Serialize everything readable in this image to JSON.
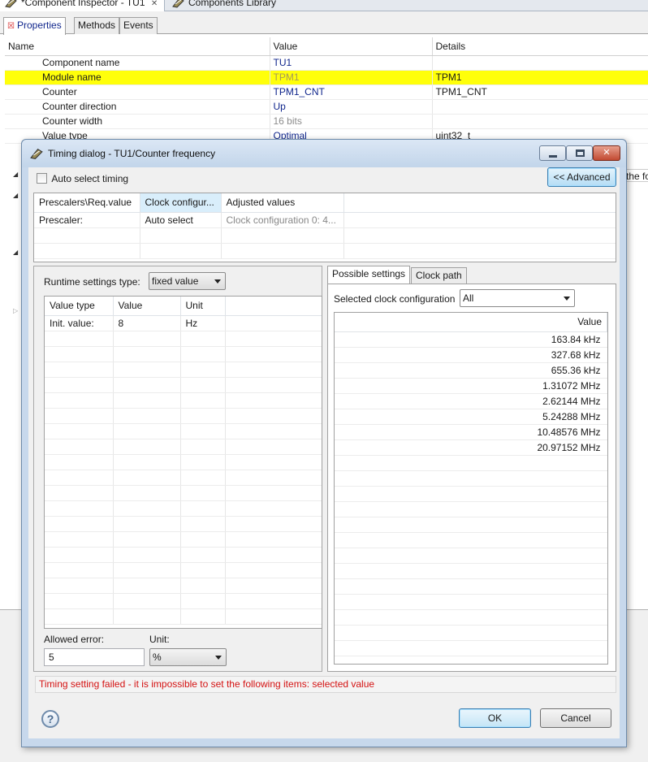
{
  "editor_tabs": [
    {
      "label": "*Component Inspector - TU1"
    },
    {
      "label": "Components Library"
    }
  ],
  "inspector": {
    "tabs": [
      "Properties",
      "Methods",
      "Events"
    ],
    "columns": [
      "Name",
      "Value",
      "Details"
    ],
    "rows": [
      {
        "name": "Component name",
        "value": "TU1",
        "details": ""
      },
      {
        "name": "Module name",
        "value": "TPM1",
        "details": "TPM1"
      },
      {
        "name": "Counter",
        "value": "TPM1_CNT",
        "details": "TPM1_CNT"
      },
      {
        "name": "Counter direction",
        "value": "Up",
        "details": ""
      },
      {
        "name": "Counter width",
        "value": "16 bits",
        "details": ""
      },
      {
        "name": "Value type",
        "value": "Optimal",
        "details": "uint32_t"
      }
    ],
    "clipped_text": "the fo"
  },
  "dialog": {
    "title": "Timing dialog - TU1/Counter frequency",
    "auto_select_label": "Auto select timing",
    "advanced_label": "<< Advanced",
    "clock_grid": {
      "columns": [
        "Prescalers\\Req.value",
        "Clock configur...",
        "Adjusted values"
      ],
      "row": {
        "c1": "Prescaler:",
        "c2": "Auto select",
        "c3": "Clock configuration 0: 4..."
      }
    },
    "runtime": {
      "label": "Runtime settings type:",
      "type_value": "fixed value",
      "columns": [
        "Value type",
        "Value",
        "Unit"
      ],
      "row": {
        "type": "Init. value:",
        "value": "8",
        "unit": "Hz"
      }
    },
    "allowed_error": {
      "label": "Allowed error:",
      "value": "5"
    },
    "unit": {
      "label": "Unit:",
      "value": "%"
    },
    "right_tabs": [
      "Possible settings",
      "Clock path"
    ],
    "clock_config": {
      "label": "Selected clock configuration",
      "value": "All"
    },
    "values_header": "Value",
    "values": [
      "163.84 kHz",
      "327.68 kHz",
      "655.36 kHz",
      "1.31072 MHz",
      "2.62144 MHz",
      "5.24288 MHz",
      "10.48576 MHz",
      "20.97152 MHz"
    ],
    "error": "Timing setting failed - it is impossible to set the following items: selected value",
    "help": "?",
    "ok_label": "OK",
    "cancel_label": "Cancel"
  }
}
